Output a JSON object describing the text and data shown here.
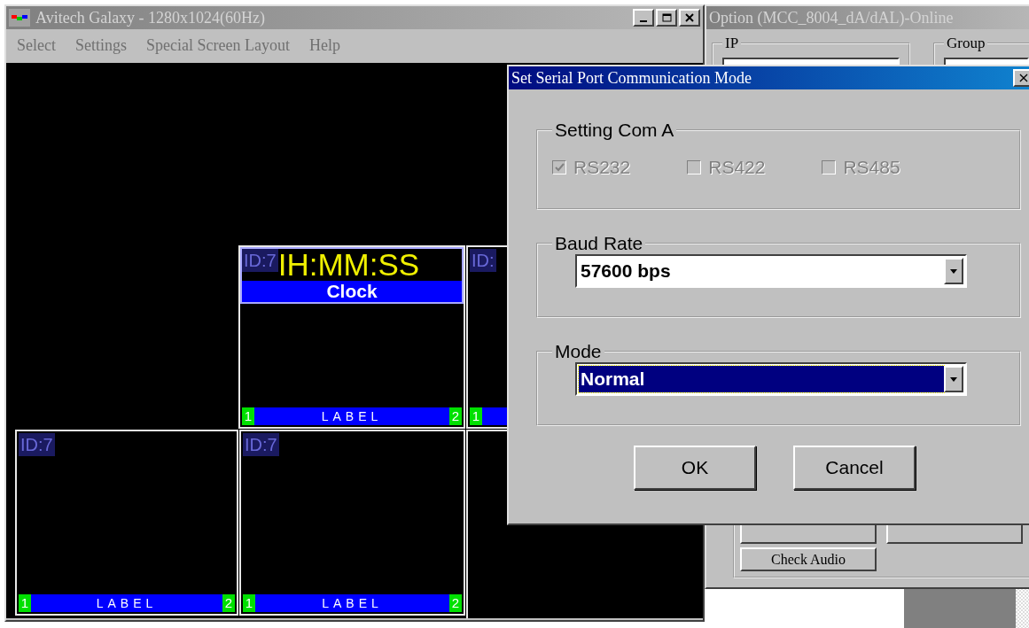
{
  "main_window": {
    "title": "Avitech Galaxy - 1280x1024(60Hz)",
    "menu": [
      "Select",
      "Settings",
      "Special Screen Layout",
      "Help"
    ],
    "tiles": [
      {
        "kind": "clock",
        "id": "ID:7",
        "time": "IH:MM:SS",
        "name": "Clock",
        "label": "LABEL",
        "left_num": "1",
        "right_num": "2"
      },
      {
        "kind": "partial",
        "id": "ID:",
        "left_num": "1"
      },
      {
        "kind": "video",
        "id": "ID:7",
        "label": "LABEL",
        "left_num": "1",
        "right_num": "2"
      },
      {
        "kind": "video",
        "id": "ID:7",
        "label": "LABEL",
        "left_num": "1",
        "right_num": "2"
      },
      {
        "kind": "empty"
      }
    ]
  },
  "option_window": {
    "title": "Option (MCC_8004_dA/dAL)-Online",
    "groups": [
      "IP",
      "Group"
    ],
    "buttons": [
      "Check Audio"
    ]
  },
  "dialog": {
    "title": "Set Serial Port Communication Mode",
    "close": "×",
    "com_group": {
      "title": "Setting Com A",
      "options": [
        {
          "label": "RS232",
          "checked": true,
          "disabled": true
        },
        {
          "label": "RS422",
          "checked": false,
          "disabled": true
        },
        {
          "label": "RS485",
          "checked": false,
          "disabled": true
        }
      ]
    },
    "baud_rate": {
      "title": "Baud Rate",
      "value": "57600 bps",
      "selected": false
    },
    "mode": {
      "title": "Mode",
      "value": "Normal",
      "selected": true
    },
    "buttons": [
      "OK",
      "Cancel"
    ]
  }
}
